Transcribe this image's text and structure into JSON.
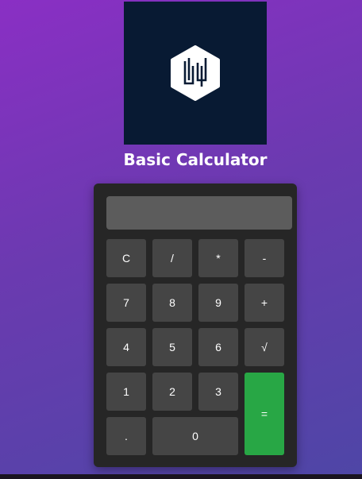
{
  "header": {
    "logo_icon": "hexagon-logo-icon",
    "title": "Basic Calculator"
  },
  "calculator": {
    "display_value": "",
    "keys": {
      "clear": "C",
      "divide": "/",
      "multiply": "*",
      "subtract": "-",
      "seven": "7",
      "eight": "8",
      "nine": "9",
      "add": "+",
      "four": "4",
      "five": "5",
      "six": "6",
      "sqrt": "√",
      "one": "1",
      "two": "2",
      "three": "3",
      "equals": "=",
      "decimal": ".",
      "zero": "0"
    }
  },
  "colors": {
    "background_start": "#8a2fc4",
    "background_end": "#4e46a6",
    "logo_background": "#081a33",
    "panel": "#262626",
    "display": "#5c5c5c",
    "key": "#454545",
    "equals_key": "#28a745"
  }
}
